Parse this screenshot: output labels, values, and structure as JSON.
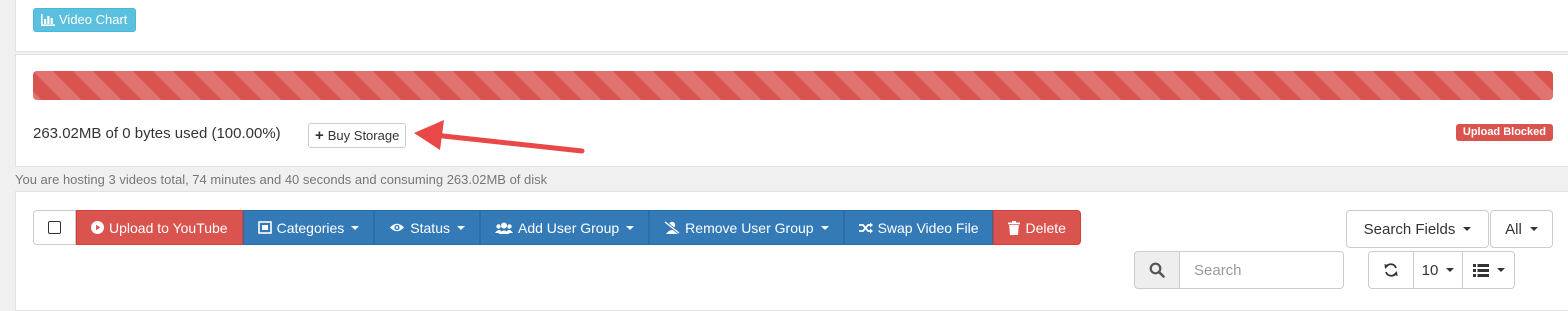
{
  "chart_button": {
    "label": "Video Chart",
    "icon": "bar-chart-icon"
  },
  "storage": {
    "usage_text": "263.02MB of 0 bytes used (100.00%)",
    "percent_used": 100,
    "bar_color": "#d9534f",
    "buy_button_label": "Buy Storage",
    "status_badge": "Upload Blocked",
    "status_color": "#d9534f"
  },
  "hosting_summary": "You are hosting 3 videos total, 74 minutes and 40 seconds and consuming 263.02MB of disk",
  "toolbar": {
    "upload_youtube": "Upload to YouTube",
    "categories": "Categories",
    "status": "Status",
    "add_user_group": "Add User Group",
    "remove_user_group": "Remove User Group",
    "swap_video_file": "Swap Video File",
    "delete": "Delete"
  },
  "search": {
    "fields_label": "Search Fields",
    "scope_label": "All",
    "placeholder": "Search"
  },
  "table_controls": {
    "page_size": "10"
  },
  "colors": {
    "info": "#5bc0de",
    "primary": "#337ab7",
    "danger": "#d9534f"
  }
}
